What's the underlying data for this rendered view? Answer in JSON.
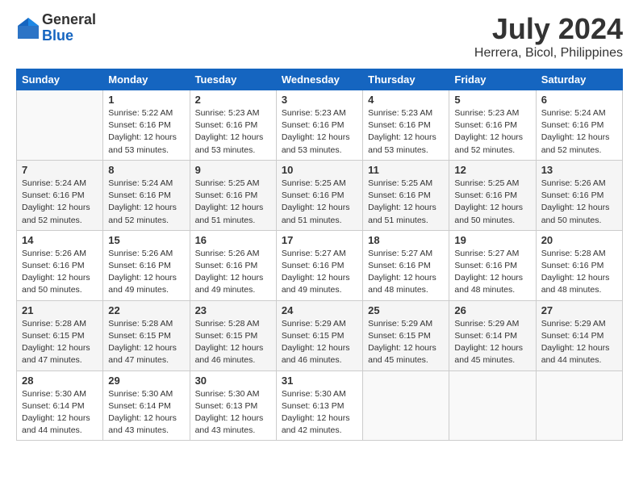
{
  "header": {
    "logo_general": "General",
    "logo_blue": "Blue",
    "month_year": "July 2024",
    "location": "Herrera, Bicol, Philippines"
  },
  "days_of_week": [
    "Sunday",
    "Monday",
    "Tuesday",
    "Wednesday",
    "Thursday",
    "Friday",
    "Saturday"
  ],
  "weeks": [
    [
      {
        "day": "",
        "info": ""
      },
      {
        "day": "1",
        "info": "Sunrise: 5:22 AM\nSunset: 6:16 PM\nDaylight: 12 hours\nand 53 minutes."
      },
      {
        "day": "2",
        "info": "Sunrise: 5:23 AM\nSunset: 6:16 PM\nDaylight: 12 hours\nand 53 minutes."
      },
      {
        "day": "3",
        "info": "Sunrise: 5:23 AM\nSunset: 6:16 PM\nDaylight: 12 hours\nand 53 minutes."
      },
      {
        "day": "4",
        "info": "Sunrise: 5:23 AM\nSunset: 6:16 PM\nDaylight: 12 hours\nand 53 minutes."
      },
      {
        "day": "5",
        "info": "Sunrise: 5:23 AM\nSunset: 6:16 PM\nDaylight: 12 hours\nand 52 minutes."
      },
      {
        "day": "6",
        "info": "Sunrise: 5:24 AM\nSunset: 6:16 PM\nDaylight: 12 hours\nand 52 minutes."
      }
    ],
    [
      {
        "day": "7",
        "info": "Sunrise: 5:24 AM\nSunset: 6:16 PM\nDaylight: 12 hours\nand 52 minutes."
      },
      {
        "day": "8",
        "info": "Sunrise: 5:24 AM\nSunset: 6:16 PM\nDaylight: 12 hours\nand 52 minutes."
      },
      {
        "day": "9",
        "info": "Sunrise: 5:25 AM\nSunset: 6:16 PM\nDaylight: 12 hours\nand 51 minutes."
      },
      {
        "day": "10",
        "info": "Sunrise: 5:25 AM\nSunset: 6:16 PM\nDaylight: 12 hours\nand 51 minutes."
      },
      {
        "day": "11",
        "info": "Sunrise: 5:25 AM\nSunset: 6:16 PM\nDaylight: 12 hours\nand 51 minutes."
      },
      {
        "day": "12",
        "info": "Sunrise: 5:25 AM\nSunset: 6:16 PM\nDaylight: 12 hours\nand 50 minutes."
      },
      {
        "day": "13",
        "info": "Sunrise: 5:26 AM\nSunset: 6:16 PM\nDaylight: 12 hours\nand 50 minutes."
      }
    ],
    [
      {
        "day": "14",
        "info": "Sunrise: 5:26 AM\nSunset: 6:16 PM\nDaylight: 12 hours\nand 50 minutes."
      },
      {
        "day": "15",
        "info": "Sunrise: 5:26 AM\nSunset: 6:16 PM\nDaylight: 12 hours\nand 49 minutes."
      },
      {
        "day": "16",
        "info": "Sunrise: 5:26 AM\nSunset: 6:16 PM\nDaylight: 12 hours\nand 49 minutes."
      },
      {
        "day": "17",
        "info": "Sunrise: 5:27 AM\nSunset: 6:16 PM\nDaylight: 12 hours\nand 49 minutes."
      },
      {
        "day": "18",
        "info": "Sunrise: 5:27 AM\nSunset: 6:16 PM\nDaylight: 12 hours\nand 48 minutes."
      },
      {
        "day": "19",
        "info": "Sunrise: 5:27 AM\nSunset: 6:16 PM\nDaylight: 12 hours\nand 48 minutes."
      },
      {
        "day": "20",
        "info": "Sunrise: 5:28 AM\nSunset: 6:16 PM\nDaylight: 12 hours\nand 48 minutes."
      }
    ],
    [
      {
        "day": "21",
        "info": "Sunrise: 5:28 AM\nSunset: 6:15 PM\nDaylight: 12 hours\nand 47 minutes."
      },
      {
        "day": "22",
        "info": "Sunrise: 5:28 AM\nSunset: 6:15 PM\nDaylight: 12 hours\nand 47 minutes."
      },
      {
        "day": "23",
        "info": "Sunrise: 5:28 AM\nSunset: 6:15 PM\nDaylight: 12 hours\nand 46 minutes."
      },
      {
        "day": "24",
        "info": "Sunrise: 5:29 AM\nSunset: 6:15 PM\nDaylight: 12 hours\nand 46 minutes."
      },
      {
        "day": "25",
        "info": "Sunrise: 5:29 AM\nSunset: 6:15 PM\nDaylight: 12 hours\nand 45 minutes."
      },
      {
        "day": "26",
        "info": "Sunrise: 5:29 AM\nSunset: 6:14 PM\nDaylight: 12 hours\nand 45 minutes."
      },
      {
        "day": "27",
        "info": "Sunrise: 5:29 AM\nSunset: 6:14 PM\nDaylight: 12 hours\nand 44 minutes."
      }
    ],
    [
      {
        "day": "28",
        "info": "Sunrise: 5:30 AM\nSunset: 6:14 PM\nDaylight: 12 hours\nand 44 minutes."
      },
      {
        "day": "29",
        "info": "Sunrise: 5:30 AM\nSunset: 6:14 PM\nDaylight: 12 hours\nand 43 minutes."
      },
      {
        "day": "30",
        "info": "Sunrise: 5:30 AM\nSunset: 6:13 PM\nDaylight: 12 hours\nand 43 minutes."
      },
      {
        "day": "31",
        "info": "Sunrise: 5:30 AM\nSunset: 6:13 PM\nDaylight: 12 hours\nand 42 minutes."
      },
      {
        "day": "",
        "info": ""
      },
      {
        "day": "",
        "info": ""
      },
      {
        "day": "",
        "info": ""
      }
    ]
  ]
}
